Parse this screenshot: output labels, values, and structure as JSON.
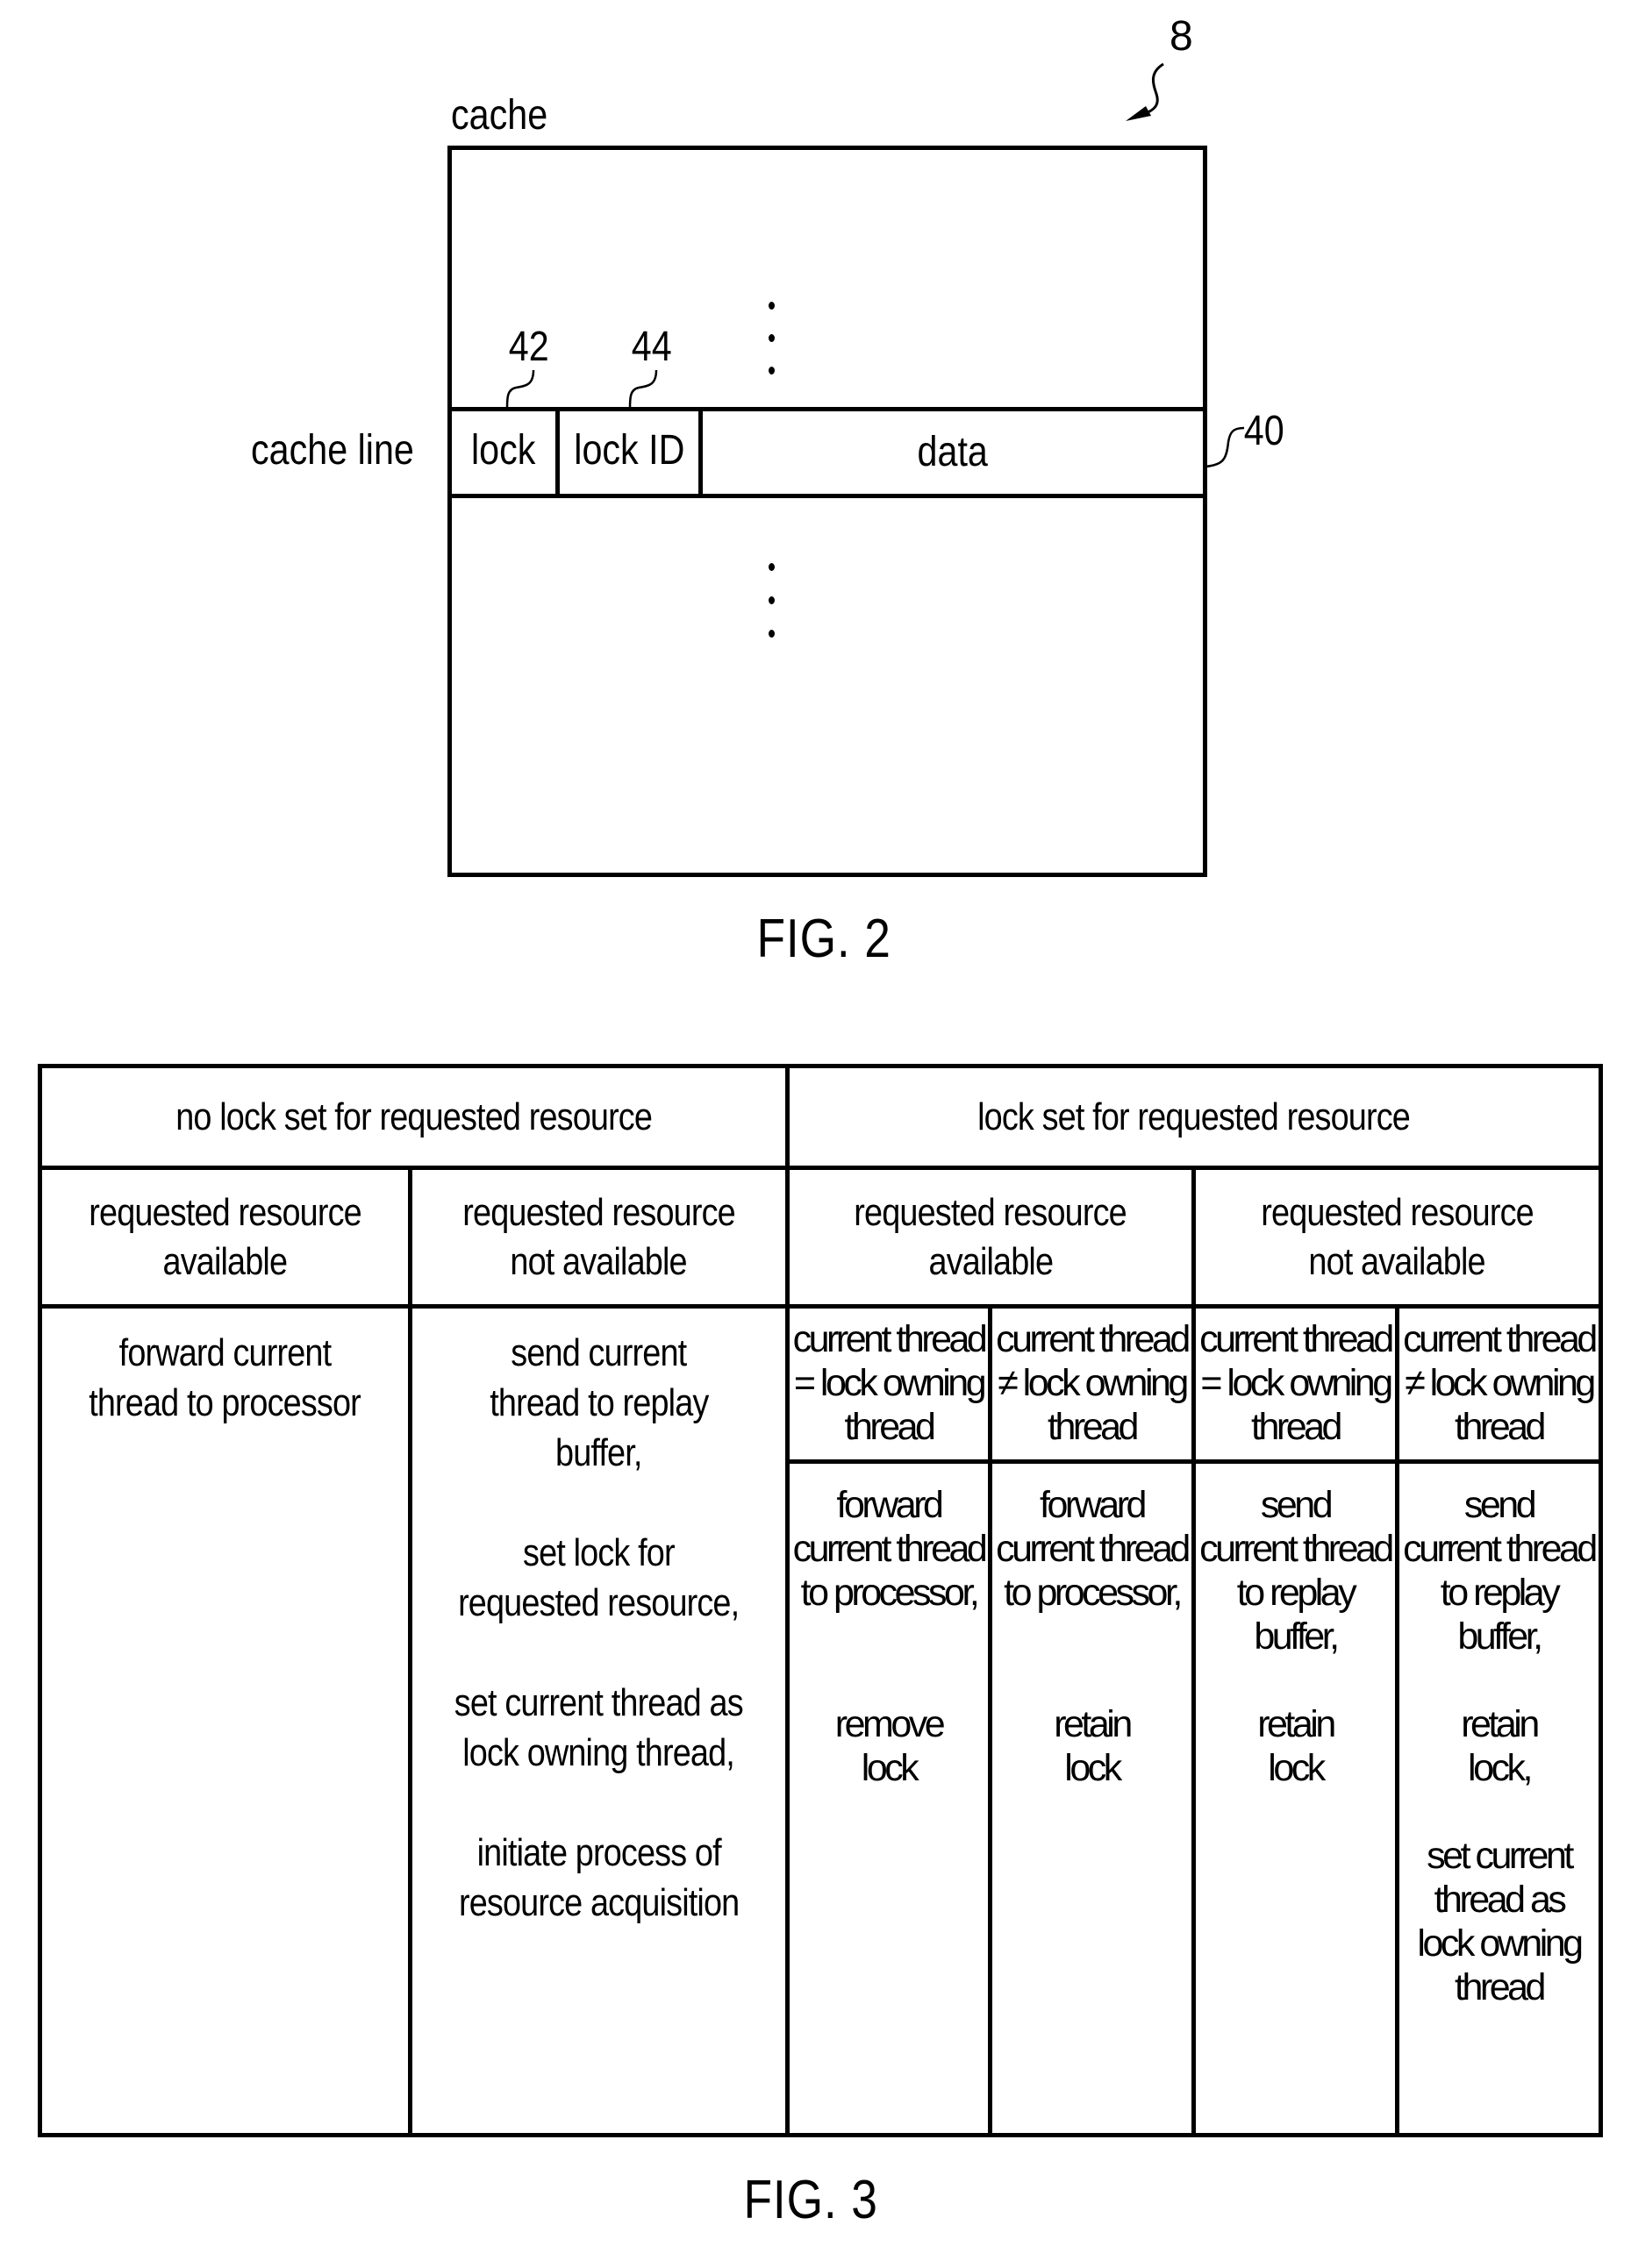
{
  "fig2": {
    "reference_numeral": "8",
    "cache_label": "cache",
    "cache_line_label": "cache line",
    "cache_line_ref": "40",
    "fields": [
      {
        "label": "lock",
        "ref": "42"
      },
      {
        "label": "lock ID",
        "ref": "44"
      },
      {
        "label": "data",
        "ref": ""
      }
    ],
    "ellipsis": "⋮",
    "caption": "FIG. 2"
  },
  "fig3": {
    "caption": "FIG. 3",
    "top_headers": [
      "no lock set for requested resource",
      "lock set for requested resource"
    ],
    "second_headers": [
      [
        "requested resource",
        "available"
      ],
      [
        "requested resource",
        "not available"
      ],
      [
        "requested resource",
        "available"
      ],
      [
        "requested resource",
        "not available"
      ]
    ],
    "thread_headers": [
      [
        "current thread",
        "= lock owning",
        "thread"
      ],
      [
        "current thread",
        "≠ lock owning",
        "thread"
      ],
      [
        "current thread",
        "= lock owning",
        "thread"
      ],
      [
        "current thread",
        "≠ lock owning",
        "thread"
      ]
    ],
    "no_lock_actions": {
      "available": [
        [
          "forward current",
          "thread to processor"
        ]
      ],
      "not_available": [
        [
          "send current",
          "thread to replay",
          "buffer,"
        ],
        [
          "set lock for",
          "requested resource,"
        ],
        [
          "set current thread as",
          "lock owning thread,"
        ],
        [
          "initiate process of",
          "resource acquisition"
        ]
      ]
    },
    "lock_actions": [
      [
        [
          "forward",
          "current thread",
          "to processor,"
        ],
        [
          "remove",
          "lock"
        ]
      ],
      [
        [
          "forward",
          "current thread",
          "to processor,"
        ],
        [
          "retain",
          "lock"
        ]
      ],
      [
        [
          "send",
          "current thread",
          "to replay",
          "buffer,"
        ],
        [
          "retain",
          "lock"
        ]
      ],
      [
        [
          "send",
          "current thread",
          "to replay",
          "buffer,"
        ],
        [
          "retain",
          "lock,"
        ],
        [
          "set current",
          "thread as",
          "lock owning",
          "thread"
        ]
      ]
    ]
  }
}
